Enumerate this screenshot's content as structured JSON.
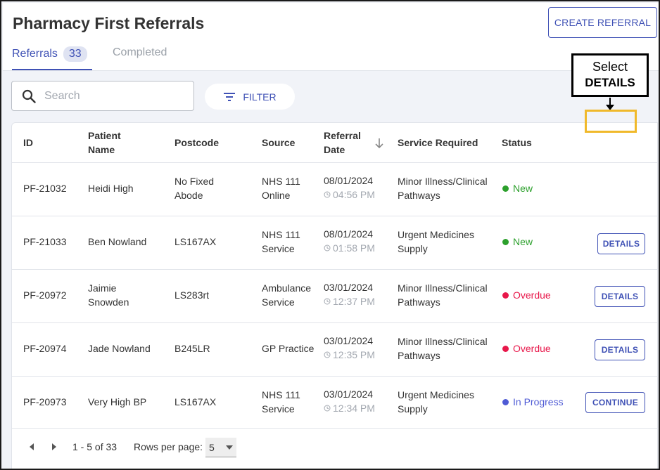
{
  "header": {
    "title": "Pharmacy First Referrals",
    "create_label": "CREATE REFERRAL"
  },
  "tabs": [
    {
      "label": "Referrals",
      "badge": "33",
      "active": true
    },
    {
      "label": "Completed",
      "active": false
    }
  ],
  "search": {
    "placeholder": "Search",
    "value": ""
  },
  "filter": {
    "label": "FILTER"
  },
  "table": {
    "columns": {
      "id": "ID",
      "patient_line1": "Patient",
      "patient_line2": "Name",
      "postcode": "Postcode",
      "source": "Source",
      "date_line1": "Referral",
      "date_line2": "Date",
      "service": "Service Required",
      "status": "Status"
    },
    "rows": [
      {
        "id": "PF-21032",
        "name1": "Heidi High",
        "name2": "",
        "postcode1": "No Fixed",
        "postcode2": "Abode",
        "source1": "NHS 111",
        "source2": "Online",
        "date": "08/01/2024",
        "time": "04:56 PM",
        "service1": "Minor Illness/Clinical",
        "service2": "Pathways",
        "status": "New",
        "action": ""
      },
      {
        "id": "PF-21033",
        "name1": "Ben Nowland",
        "name2": "",
        "postcode1": "LS167AX",
        "postcode2": "",
        "source1": "NHS 111",
        "source2": "Service",
        "date": "08/01/2024",
        "time": "01:58 PM",
        "service1": "Urgent Medicines",
        "service2": "Supply",
        "status": "New",
        "action": "DETAILS"
      },
      {
        "id": "PF-20972",
        "name1": "Jaimie",
        "name2": "Snowden",
        "postcode1": "LS283rt",
        "postcode2": "",
        "source1": "Ambulance",
        "source2": "Service",
        "date": "03/01/2024",
        "time": "12:37 PM",
        "service1": "Minor Illness/Clinical",
        "service2": "Pathways",
        "status": "Overdue",
        "action": "DETAILS"
      },
      {
        "id": "PF-20974",
        "name1": "Jade Nowland",
        "name2": "",
        "postcode1": "B245LR",
        "postcode2": "",
        "source1": "GP Practice",
        "source2": "",
        "date": "03/01/2024",
        "time": "12:35 PM",
        "service1": "Minor Illness/Clinical",
        "service2": "Pathways",
        "status": "Overdue",
        "action": "DETAILS"
      },
      {
        "id": "PF-20973",
        "name1": "Very High BP",
        "name2": "",
        "postcode1": "LS167AX",
        "postcode2": "",
        "source1": "NHS 111",
        "source2": "Service",
        "date": "03/01/2024",
        "time": "12:34 PM",
        "service1": "Urgent Medicines",
        "service2": "Supply",
        "status": "In Progress",
        "action": "CONTINUE"
      }
    ]
  },
  "status_colors": {
    "New": "#2ca02c",
    "Overdue": "#e8174a",
    "In Progress": "#4f5bd5"
  },
  "pagination": {
    "range": "1 - 5 of 33",
    "rows_label": "Rows per page:",
    "rows_value": "5"
  },
  "callout": {
    "line1": "Select",
    "line2": "DETAILS"
  },
  "colors": {
    "accent": "#3f51b5",
    "highlight": "#f0b92b"
  }
}
